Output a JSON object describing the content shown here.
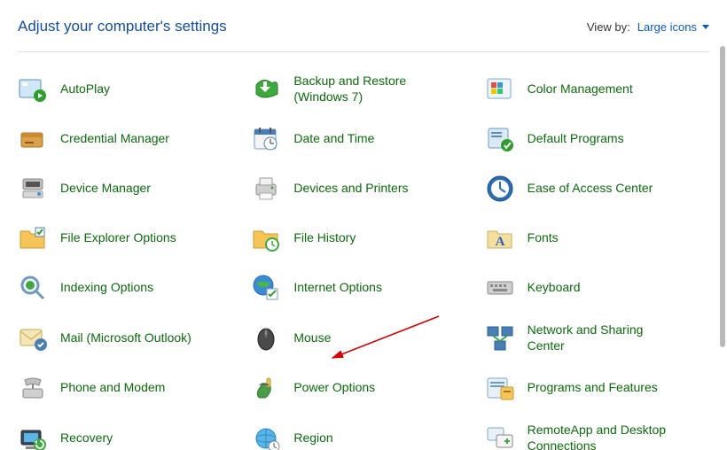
{
  "header": {
    "title": "Adjust your computer's settings",
    "viewByLabel": "View by:",
    "viewByValue": "Large icons"
  },
  "items": [
    {
      "id": "autoplay",
      "label": "AutoPlay",
      "icon": "autoplay"
    },
    {
      "id": "backup-restore",
      "label": "Backup and Restore (Windows 7)",
      "icon": "backup"
    },
    {
      "id": "color-management",
      "label": "Color Management",
      "icon": "color"
    },
    {
      "id": "credential-manager",
      "label": "Credential Manager",
      "icon": "credential"
    },
    {
      "id": "date-time",
      "label": "Date and Time",
      "icon": "datetime"
    },
    {
      "id": "default-programs",
      "label": "Default Programs",
      "icon": "default-programs"
    },
    {
      "id": "device-manager",
      "label": "Device Manager",
      "icon": "device-manager"
    },
    {
      "id": "devices-printers",
      "label": "Devices and Printers",
      "icon": "printers"
    },
    {
      "id": "ease-of-access",
      "label": "Ease of Access Center",
      "icon": "ease"
    },
    {
      "id": "file-explorer-options",
      "label": "File Explorer Options",
      "icon": "folder-options"
    },
    {
      "id": "file-history",
      "label": "File History",
      "icon": "file-history"
    },
    {
      "id": "fonts",
      "label": "Fonts",
      "icon": "fonts"
    },
    {
      "id": "indexing-options",
      "label": "Indexing Options",
      "icon": "indexing"
    },
    {
      "id": "internet-options",
      "label": "Internet Options",
      "icon": "internet"
    },
    {
      "id": "keyboard",
      "label": "Keyboard",
      "icon": "keyboard"
    },
    {
      "id": "mail",
      "label": "Mail (Microsoft Outlook)",
      "icon": "mail"
    },
    {
      "id": "mouse",
      "label": "Mouse",
      "icon": "mouse"
    },
    {
      "id": "network-sharing",
      "label": "Network and Sharing Center",
      "icon": "network"
    },
    {
      "id": "phone-modem",
      "label": "Phone and Modem",
      "icon": "phone"
    },
    {
      "id": "power-options",
      "label": "Power Options",
      "icon": "power"
    },
    {
      "id": "programs-features",
      "label": "Programs and Features",
      "icon": "programs"
    },
    {
      "id": "recovery",
      "label": "Recovery",
      "icon": "recovery"
    },
    {
      "id": "region",
      "label": "Region",
      "icon": "region"
    },
    {
      "id": "remoteapp",
      "label": "RemoteApp and Desktop Connections",
      "icon": "remoteapp"
    }
  ]
}
